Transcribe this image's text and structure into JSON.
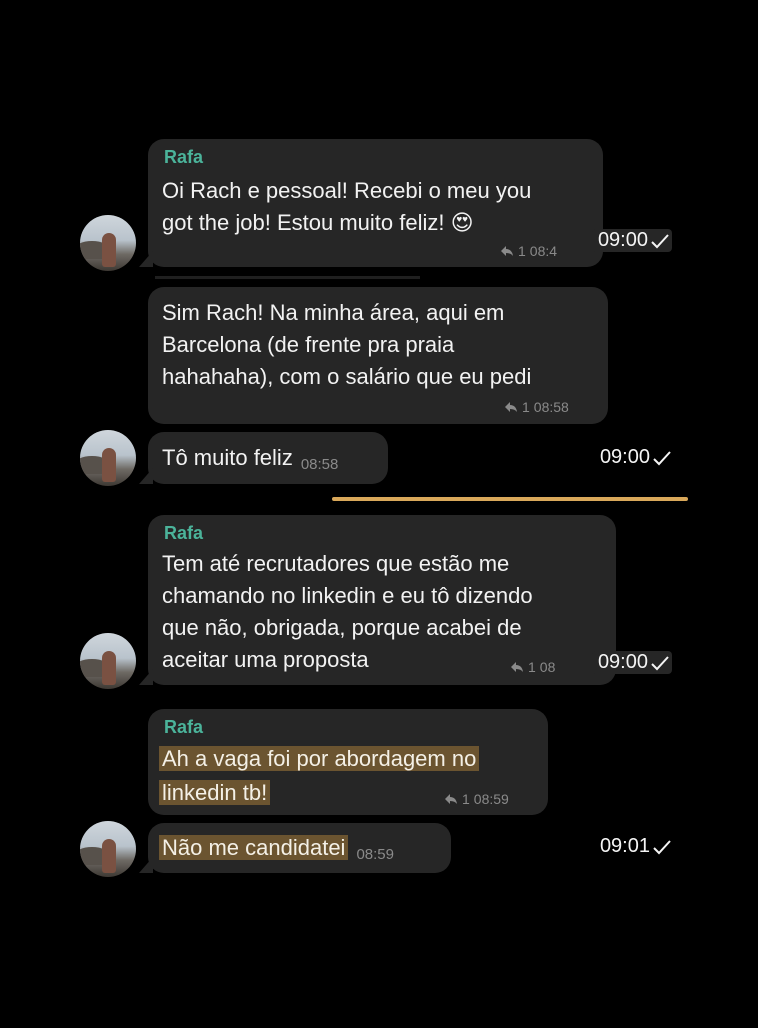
{
  "chat": {
    "sender_name": "Rafa",
    "messages": [
      {
        "id": "m1",
        "sender": "Rafa",
        "lines": [
          "Oi Rach e pessoal! Recebi o meu you",
          "got the job! Estou muito feliz! 😍"
        ],
        "reply_count": "1",
        "time": "08:4",
        "status_time": "09:00"
      },
      {
        "id": "m2",
        "lines": [
          "Sim Rach! Na minha área, aqui em",
          "Barcelona (de frente pra praia",
          "hahahaha), com o salário que eu pedi"
        ],
        "reply_count": "1",
        "time": "08:58"
      },
      {
        "id": "m3",
        "lines": [
          "Tô muito feliz"
        ],
        "time": "08:58",
        "status_time": "09:00"
      },
      {
        "id": "m4",
        "sender": "Rafa",
        "lines": [
          "Tem até recrutadores que estão me",
          "chamando no linkedin e eu tô dizendo",
          "que não, obrigada, porque acabei de",
          "aceitar uma proposta"
        ],
        "reply_count": "1",
        "time": "08",
        "status_time": "09:00"
      },
      {
        "id": "m5",
        "sender": "Rafa",
        "lines": [
          "Ah a vaga foi por abordagem no",
          "linkedin tb!"
        ],
        "reply_count": "1",
        "time": "08:59"
      },
      {
        "id": "m6",
        "lines": [
          "Não me candidatei"
        ],
        "time": "08:59",
        "status_time": "09:01"
      }
    ]
  },
  "colors": {
    "background": "#000000",
    "bubble": "#262626",
    "sender": "#4bb39a",
    "highlight": "#6b5430",
    "divider": "#d9a85a"
  },
  "icons": {
    "reply": "reply-arrow-icon",
    "check": "check-icon",
    "emoji": "heart-eyes-emoji"
  }
}
